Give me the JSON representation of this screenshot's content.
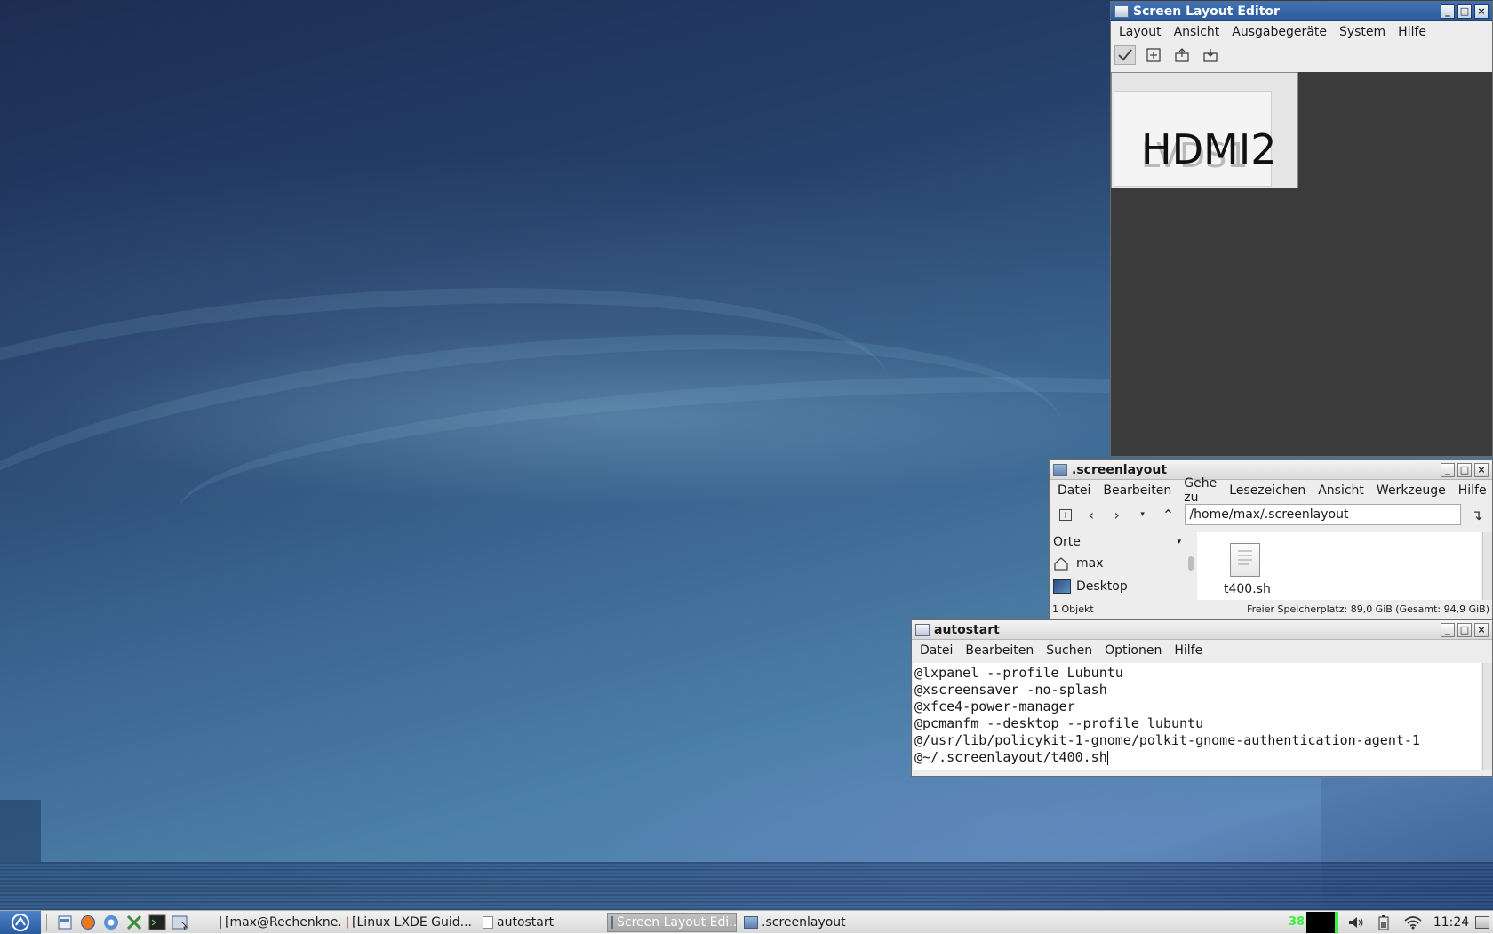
{
  "screen_layout_editor": {
    "title": "Screen Layout Editor",
    "menu": [
      "Layout",
      "Ansicht",
      "Ausgabegeräte",
      "System",
      "Hilfe"
    ],
    "toolbar_icons": [
      "apply-icon",
      "new-layout-icon",
      "open-layout-icon",
      "save-layout-icon"
    ],
    "outputs": {
      "secondary": "LVDS1",
      "primary": "HDMI2"
    }
  },
  "file_manager": {
    "title": ".screenlayout",
    "menu": [
      "Datei",
      "Bearbeiten",
      "Gehe zu",
      "Lesezeichen",
      "Ansicht",
      "Werkzeuge",
      "Hilfe"
    ],
    "path": "/home/max/.screenlayout",
    "sidebar": {
      "heading": "Orte",
      "items": [
        "max",
        "Desktop"
      ]
    },
    "files": [
      {
        "name": "t400.sh",
        "icon": "script-file-icon"
      }
    ],
    "status": {
      "count": "1 Objekt",
      "free_space": "Freier Speicherplatz: 89,0 GiB (Gesamt: 94,9 GiB)"
    }
  },
  "text_editor": {
    "title": "autostart",
    "menu": [
      "Datei",
      "Bearbeiten",
      "Suchen",
      "Optionen",
      "Hilfe"
    ],
    "lines": [
      "@lxpanel --profile Lubuntu",
      "@xscreensaver -no-splash",
      "@xfce4-power-manager",
      "@pcmanfm --desktop --profile lubuntu",
      "@/usr/lib/policykit-1-gnome/polkit-gnome-authentication-agent-1",
      "@~/.screenlayout/t400.sh"
    ]
  },
  "taskbar": {
    "launchers": [
      "file-manager-icon",
      "firefox-icon",
      "chromium-icon",
      "settings-tools-icon",
      "terminal-icon",
      "window-switch-icon"
    ],
    "tasks": [
      {
        "label": "[max@Rechenkne...",
        "icon": "terminal-icon",
        "active": false
      },
      {
        "label": "[Linux LXDE Guid...",
        "icon": "firefox-icon",
        "active": false
      },
      {
        "label": "autostart",
        "icon": "text-file-icon",
        "active": false
      },
      {
        "label": "Screen Layout Edi...",
        "icon": "window-icon",
        "active": true
      },
      {
        "label": ".screenlayout",
        "icon": "folder-icon",
        "active": false
      }
    ],
    "cpu_value": "38",
    "clock": "11:24",
    "tray_icons": [
      "volume-icon",
      "battery-icon",
      "wifi-icon"
    ]
  },
  "colors": {
    "accent": "#2d5a99",
    "cpu_text": "#3ef03e"
  }
}
